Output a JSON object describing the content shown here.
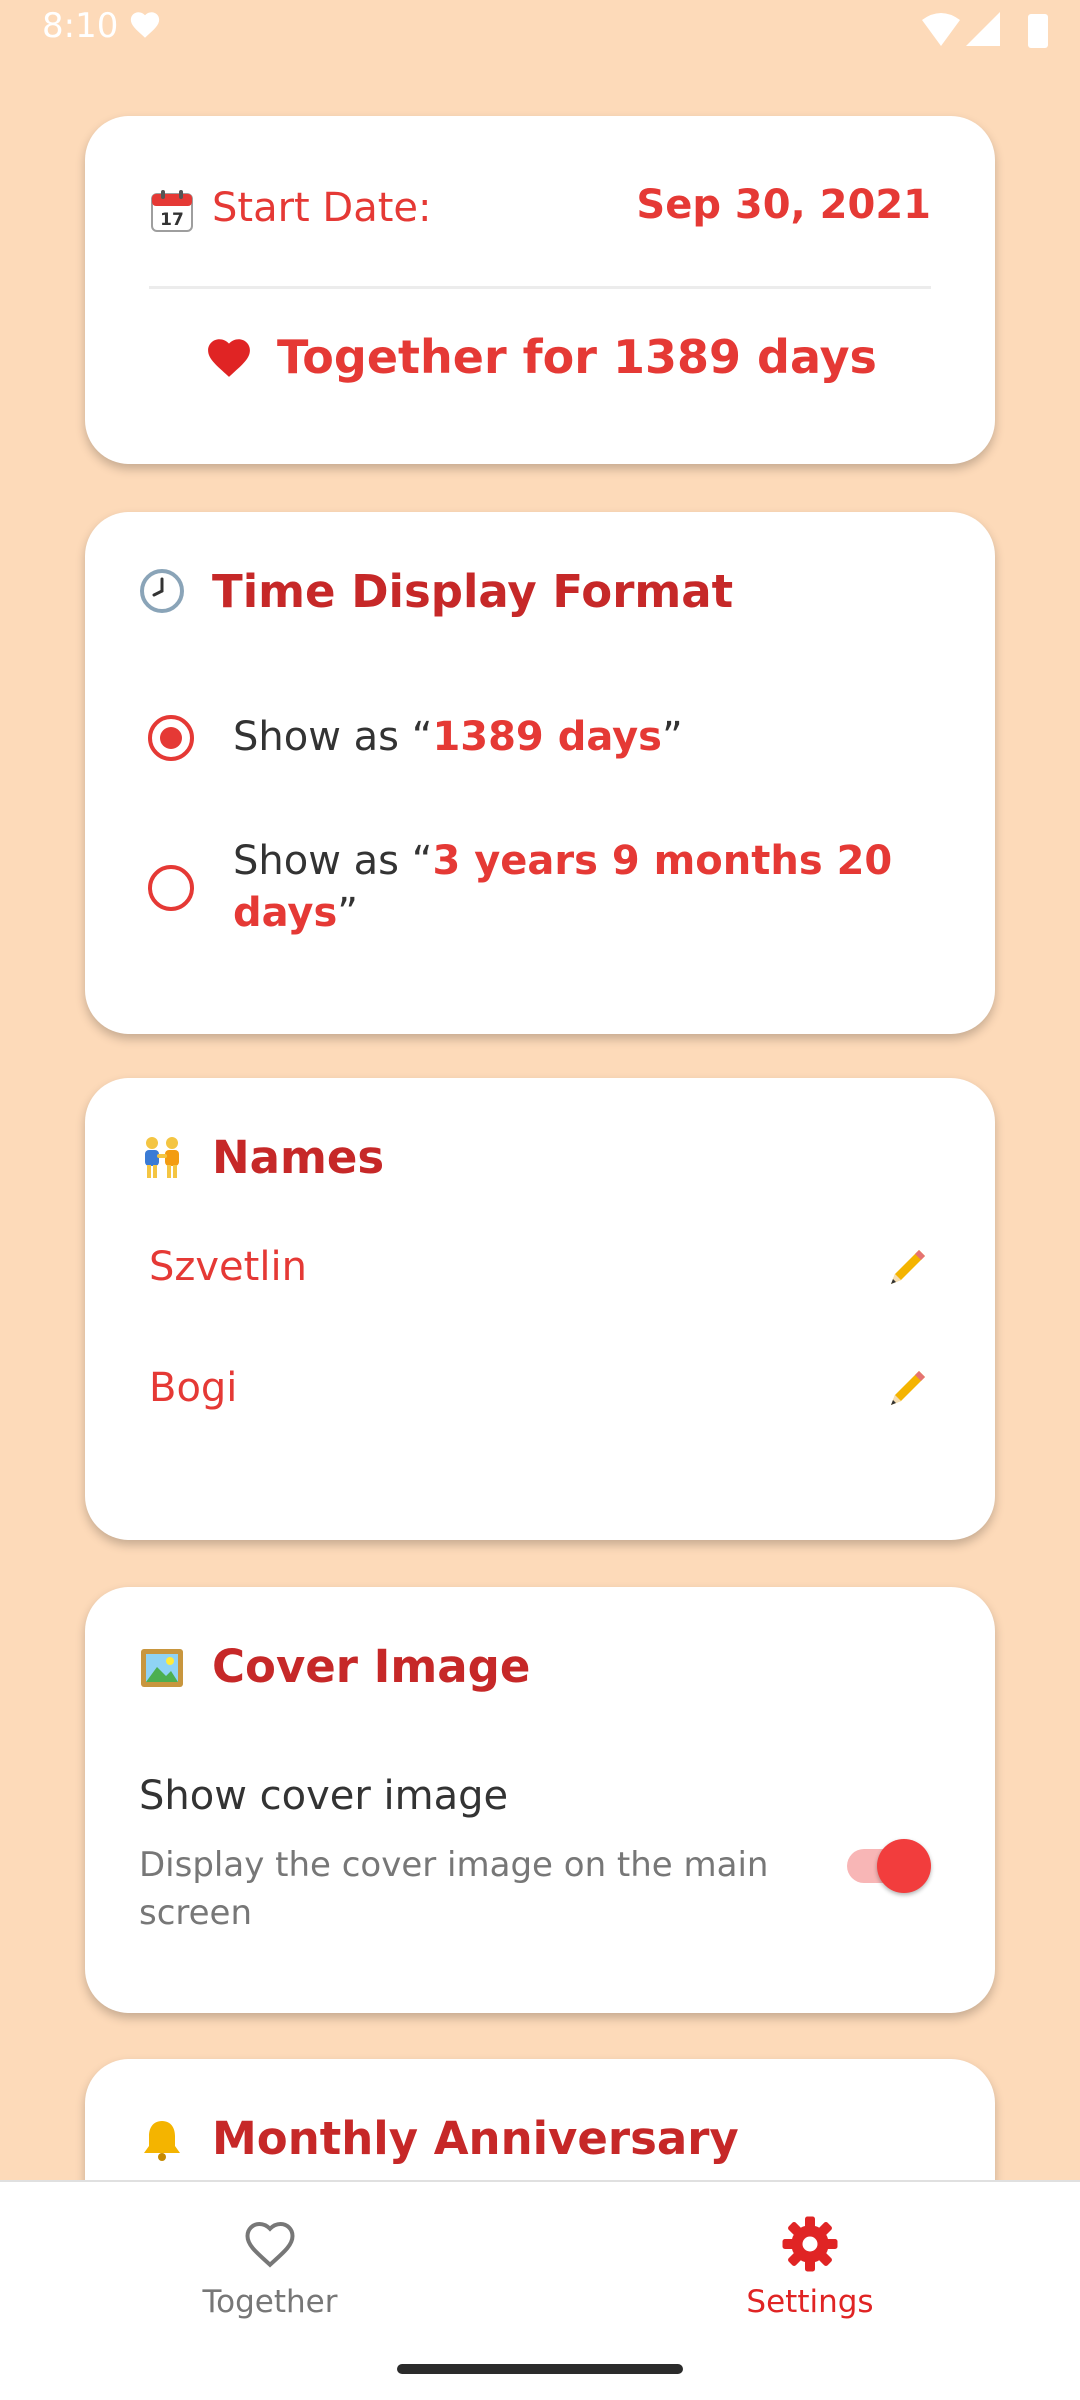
{
  "status_bar": {
    "time": "8:10",
    "icons": [
      "heart-icon",
      "wifi-icon",
      "signal-icon",
      "battery-icon"
    ]
  },
  "start_date": {
    "icon": "calendar-icon",
    "label": "Start Date:",
    "value": "Sep 30, 2021"
  },
  "together": {
    "icon": "red-heart-icon",
    "text": "Together for 1389 days"
  },
  "time_format": {
    "icon": "clock-icon",
    "title": "Time Display Format",
    "options": [
      {
        "prefix": "Show as “",
        "value": "1389 days",
        "suffix": "”",
        "selected": true
      },
      {
        "prefix": "Show as “",
        "value": "3 years 9 months 20 days",
        "suffix": "”",
        "selected": false
      }
    ]
  },
  "names": {
    "icon": "couple-icon",
    "title": "Names",
    "items": [
      {
        "name": "Szvetlin"
      },
      {
        "name": "Bogi"
      }
    ]
  },
  "cover_image": {
    "icon": "picture-icon",
    "title": "Cover Image",
    "toggle_title": "Show cover image",
    "toggle_subtitle": "Display the cover image on the main screen",
    "enabled": true
  },
  "monthly_anniversary": {
    "icon": "bell-icon",
    "title": "Monthly Anniversary"
  },
  "bottom_nav": {
    "items": [
      {
        "label": "Together",
        "icon": "heart-outline-icon",
        "active": false
      },
      {
        "label": "Settings",
        "icon": "gear-icon",
        "active": true
      }
    ]
  },
  "colors": {
    "background": "#FDDAB9",
    "accent": "#E53935",
    "title": "#C62828",
    "inactive": "#777777"
  }
}
